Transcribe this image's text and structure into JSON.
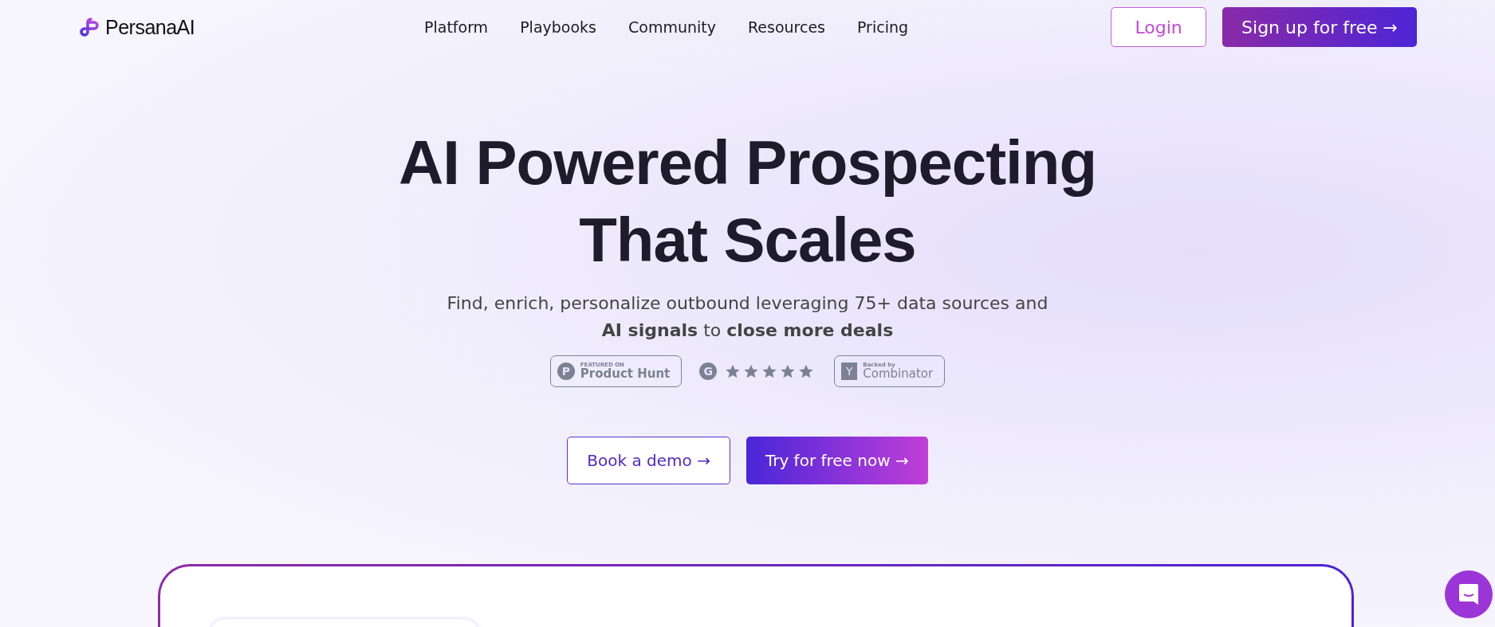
{
  "header": {
    "logo": "PersanaAI",
    "nav": [
      "Platform",
      "Playbooks",
      "Community",
      "Resources",
      "Pricing"
    ],
    "login": "Login",
    "signup": "Sign up for free",
    "signup_arrow": "→"
  },
  "hero": {
    "title_lines": [
      "AI Powered Prospecting",
      "That Scales"
    ],
    "subtitle_line1": "Find, enrich, personalize outbound leveraging 75+ data sources and",
    "subtitle_line2": "**AI signals** to **close more deals**",
    "badges": [
      {
        "kind": "producthunt",
        "mark": "P",
        "small": "FEATURED ON",
        "text": "Product Hunt"
      },
      {
        "kind": "rating",
        "mark": "G",
        "stars": 5
      },
      {
        "kind": "yc",
        "mark": "Y",
        "small": "Backed by",
        "text": "Combinator"
      }
    ],
    "buttons": [
      {
        "kind": "outline",
        "label": "Book a demo",
        "arrow": "→"
      },
      {
        "kind": "gradient",
        "label": "Try for free now",
        "arrow": "→"
      }
    ]
  }
}
